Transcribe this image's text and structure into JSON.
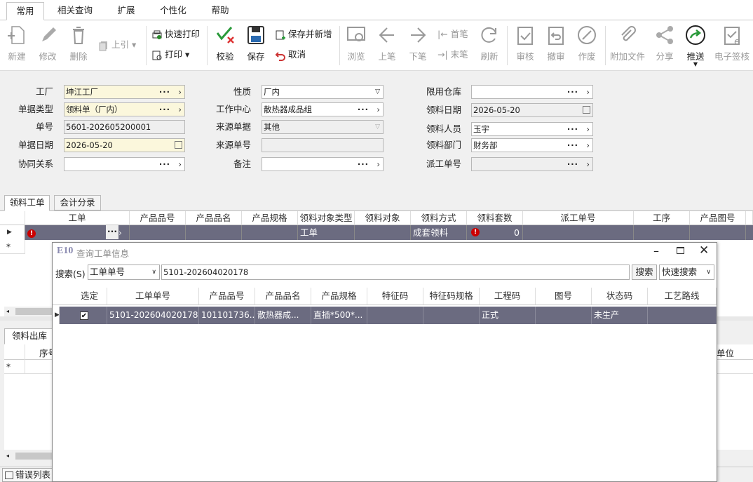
{
  "menu_tabs": [
    "常用",
    "相关查询",
    "扩展",
    "个性化",
    "帮助"
  ],
  "ribbon": {
    "new": "新建",
    "edit": "修改",
    "delete": "删除",
    "pull_up": "上引",
    "quick_print": "快速打印",
    "print": "打印",
    "verify": "校验",
    "save": "保存",
    "save_new": "保存并新增",
    "cancel": "取消",
    "browse": "浏览",
    "prev": "上笔",
    "next": "下笔",
    "first": "首笔",
    "last": "末笔",
    "refresh": "刷新",
    "approve": "审核",
    "unapprove": "撤审",
    "void": "作废",
    "attach": "附加文件",
    "share": "分享",
    "push": "推送",
    "esign": "电子签核"
  },
  "form": {
    "factory_label": "工厂",
    "factory_value": "坤江工厂",
    "doctype_label": "单据类型",
    "doctype_value": "领料单（厂内）",
    "docno_label": "单号",
    "docno_value": "5601-202605200001",
    "docdate_label": "单据日期",
    "docdate_value": "2026-05-20",
    "collab_label": "协同关系",
    "collab_value": "",
    "nature_label": "性质",
    "nature_value": "厂内",
    "workcenter_label": "工作中心",
    "workcenter_value": "散热器成品组",
    "srcdoc_label": "来源单据",
    "srcdoc_value": "其他",
    "srcno_label": "来源单号",
    "srcno_value": "",
    "remark_label": "备注",
    "remark_value": "",
    "warehouse_label": "限用仓库",
    "warehouse_value": "",
    "pickdate_label": "领料日期",
    "pickdate_value": "2026-05-20",
    "picker_label": "领料人员",
    "picker_value": "玉宇",
    "dept_label": "领料部门",
    "dept_value": "财务部",
    "dispatch_label": "派工单号",
    "dispatch_value": ""
  },
  "grid_tabs": [
    "领料工单",
    "会计分录"
  ],
  "grid": {
    "headers": [
      "工单",
      "产品品号",
      "产品品名",
      "产品规格",
      "领料对象类型",
      "领料对象",
      "领料方式",
      "领料套数",
      "派工单号",
      "工序",
      "产品图号"
    ],
    "row": {
      "object_type": "工单",
      "method": "成套领料",
      "sets": "0"
    }
  },
  "bottom": {
    "tab_label": "领料出库明",
    "col_seq": "序号",
    "col_unit": "单位",
    "status_tab": "错误列表"
  },
  "dialog": {
    "logo": "E10",
    "title": "查询工单信息",
    "search_label": "搜索(S)",
    "search_field": "工单单号",
    "search_value": "5101-202604020178",
    "search_btn": "搜索",
    "quick_search": "快速搜索",
    "headers": [
      "选定",
      "工单单号",
      "产品品号",
      "产品品名",
      "产品规格",
      "特征码",
      "特征码规格",
      "工程码",
      "图号",
      "状态码",
      "工艺路线"
    ],
    "row": {
      "selected": true,
      "wo_no": "5101-202604020178",
      "item_no": "101101736...",
      "item_name": "散热器成...",
      "spec": "直插*500*...",
      "feature": "",
      "feature_spec": "",
      "project": "正式",
      "drawing": "",
      "status": "未生产",
      "route": ""
    }
  },
  "colors": {
    "row_selected": "#6b6b80",
    "required_field": "#fbf7dc",
    "error": "#cc0000"
  }
}
